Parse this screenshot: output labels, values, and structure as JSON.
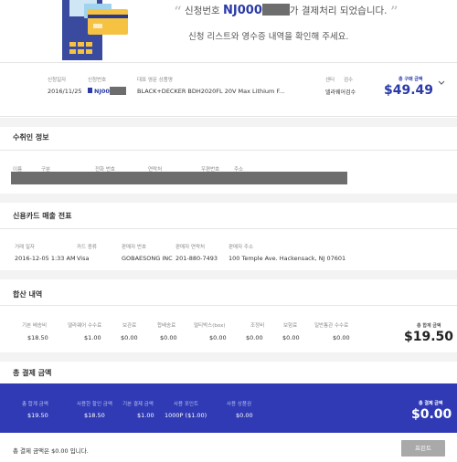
{
  "hero": {
    "line1_prefix": "신청번호",
    "order_prefix": "NJ000",
    "line1_suffix": "가 결제처리 되었습니다.",
    "line2": "신청 리스트와 영수증 내역을 확인해 주세요."
  },
  "order": {
    "date_label": "신청일자",
    "date": "2016/11/25",
    "number_label": "신청번호",
    "number_prefix": "NJ000",
    "product_label": "대표 영문 상품명",
    "product": "BLACK+DECKER BDH2020FL 20V Max Lithium F...",
    "center_label": "센터",
    "status_label": "검수",
    "status_value": "델라웨어검수",
    "total_label": "총 구매 금액",
    "total": "$49.49"
  },
  "recipient": {
    "title": "수취인 정보",
    "cols": [
      "이름",
      "구분",
      "전화 번호",
      "연락처",
      "우편번호",
      "주소"
    ]
  },
  "card": {
    "title": "신용카드 매출 전표",
    "cols": [
      "거래 일자",
      "카드 종류",
      "판매자 번호",
      "판매자 연락처",
      "판매자 주소"
    ],
    "values": [
      "2016-12-05 1:33 AM",
      "Visa",
      "GOBAESONG INC",
      "201-880-7493",
      "100 Temple Ave. Hackensack, NJ 07601"
    ]
  },
  "sum": {
    "title": "합산 내역",
    "cols": [
      "기본 배송비",
      "델라웨어 수수료",
      "보관료",
      "합배송료",
      "멀티박스(box)",
      "조정비",
      "보험료",
      "일반통관 수수료"
    ],
    "values": [
      "$18.50",
      "$1.00",
      "$0.00",
      "$0.00",
      "$0.00",
      "$0.00",
      "$0.00",
      "$0.00"
    ],
    "total_label": "총 합계 금액",
    "total": "$19.50"
  },
  "payment": {
    "title": "총 결제 금액",
    "cols": [
      "총 합계 금액",
      "사용한 할인 금액",
      "기본 결제 금액",
      "사용 포인트",
      "사용 상품권"
    ],
    "values": [
      "$19.50",
      "$18.50",
      "$1.00",
      "1000P ($1.00)",
      "$0.00"
    ],
    "total_label": "총 결제 금액",
    "total": "$0.00"
  },
  "footer": {
    "text": "총 결제 금액은 $0.00 입니다.",
    "print_label": "프린트"
  },
  "colors": {
    "accent": "#2a3aa8",
    "band": "#2f3ab4",
    "button": "#a9a9a9"
  }
}
